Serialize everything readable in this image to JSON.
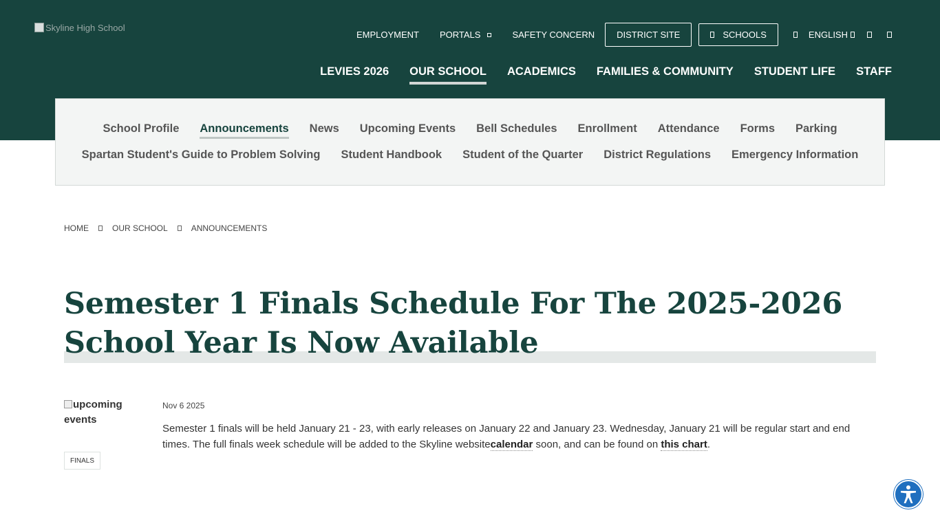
{
  "logo": {
    "alt": "Skyline High School"
  },
  "utility_nav": {
    "employment": "EMPLOYMENT",
    "portals": "PORTALS",
    "safety": "SAFETY CONCERN",
    "district_site": "DISTRICT SITE",
    "schools": "SCHOOLS",
    "language": "ENGLISH"
  },
  "main_nav": [
    {
      "label": "LEVIES 2026"
    },
    {
      "label": "OUR SCHOOL",
      "active": true
    },
    {
      "label": "ACADEMICS"
    },
    {
      "label": "FAMILIES & COMMUNITY"
    },
    {
      "label": "STUDENT LIFE"
    },
    {
      "label": "STAFF"
    }
  ],
  "sub_nav": {
    "row1": [
      "School Profile",
      "Announcements",
      "News",
      "Upcoming Events",
      "Bell Schedules",
      "Enrollment",
      "Attendance",
      "Forms",
      "Parking"
    ],
    "row2": [
      "Spartan Student's Guide to Problem Solving",
      "Student Handbook",
      "Student of the Quarter",
      "District Regulations",
      "Emergency Information"
    ],
    "active": "Announcements"
  },
  "breadcrumb": [
    "HOME",
    "OUR SCHOOL",
    "ANNOUNCEMENTS"
  ],
  "article": {
    "title": "Semester 1 Finals Schedule For The 2025-2026 School Year Is Now Available",
    "image_alt": "upcoming events",
    "tag": "FINALS",
    "date": "Nov 6 2025",
    "body_part1": "Semester 1 finals will be held January 21 - 23, with early releases on January 22 and January 23.  Wednesday, January 21 will be regular start and end times.  The full finals week schedule will be added to the Skyline website",
    "link_calendar": "calendar",
    "body_part2": " soon, and can be found on ",
    "link_chart": "this chart",
    "body_part3": "."
  },
  "colors": {
    "header_bg": "#17443e",
    "title": "#17443e",
    "subnav_bg": "#f3f5f4",
    "accessibility_button": "#1f6fbf"
  },
  "icons": {
    "accessibility": "accessibility-icon",
    "breadcrumb_separator": "chevron-right-icon",
    "portals_caret": "chevron-down-icon",
    "schools": "school-icon",
    "language": "globe-icon"
  }
}
